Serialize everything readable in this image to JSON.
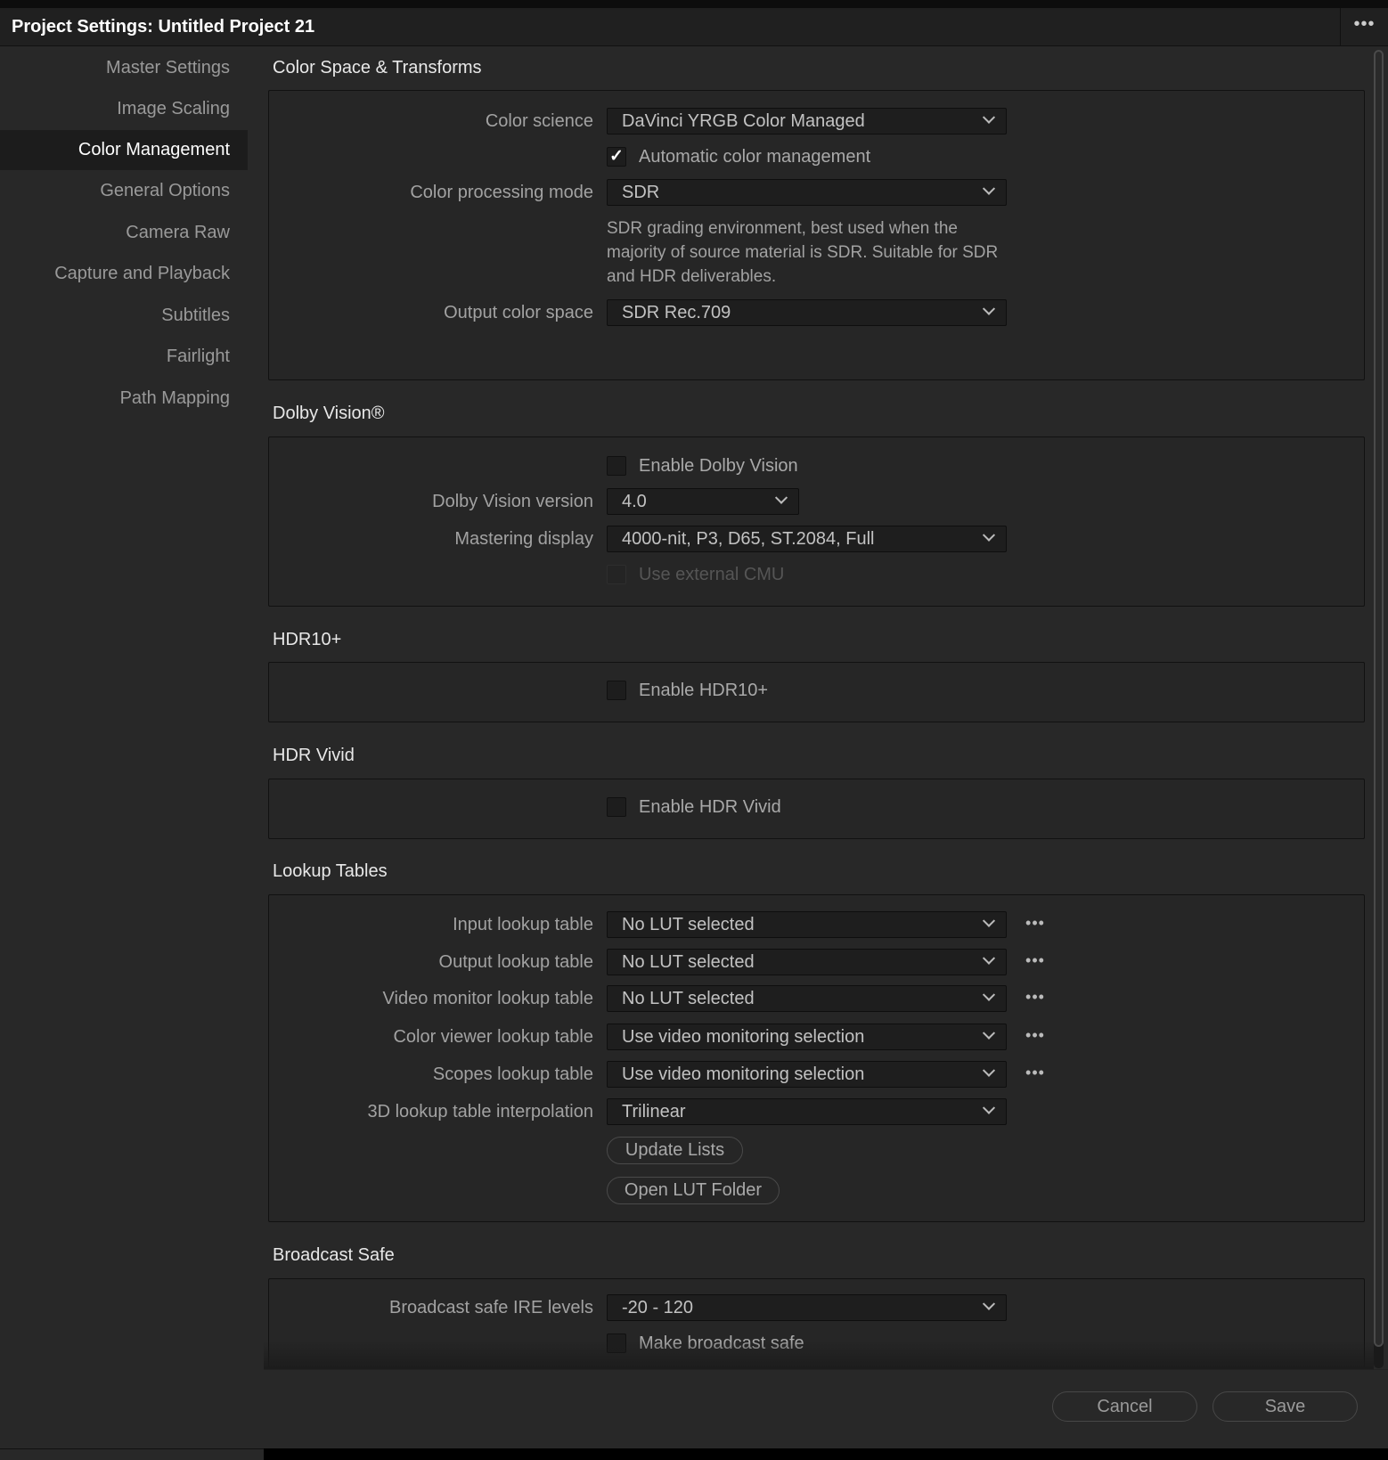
{
  "window": {
    "title": "Project Settings:  Untitled Project 21",
    "menu_icon": "more-horizontal-icon",
    "menu_glyph": "•••"
  },
  "sidebar": {
    "items": [
      {
        "label": "Master Settings"
      },
      {
        "label": "Image Scaling"
      },
      {
        "label": "Color Management",
        "selected": true
      },
      {
        "label": "General Options"
      },
      {
        "label": "Camera Raw"
      },
      {
        "label": "Capture and Playback"
      },
      {
        "label": "Subtitles"
      },
      {
        "label": "Fairlight"
      },
      {
        "label": "Path Mapping"
      }
    ]
  },
  "color_space": {
    "title": "Color Space & Transforms",
    "color_science": {
      "label": "Color science",
      "value": "DaVinci YRGB Color Managed"
    },
    "auto_cm": {
      "label": "Automatic color management",
      "checked": true,
      "glyph": "✓"
    },
    "processing_mode": {
      "label": "Color processing mode",
      "value": "SDR"
    },
    "description": "SDR grading environment, best used when the majority of source material is SDR. Suitable for SDR and HDR deliverables.",
    "output_space": {
      "label": "Output color space",
      "value": "SDR Rec.709"
    }
  },
  "dolby": {
    "title": "Dolby Vision®",
    "enable": {
      "label": "Enable Dolby Vision",
      "checked": false
    },
    "version": {
      "label": "Dolby Vision version",
      "value": "4.0"
    },
    "mastering": {
      "label": "Mastering display",
      "value": "4000-nit, P3, D65, ST.2084, Full"
    },
    "external_cmu": {
      "label": "Use external CMU",
      "checked": false,
      "disabled": true
    }
  },
  "hdr10": {
    "title": "HDR10+",
    "enable": {
      "label": "Enable HDR10+",
      "checked": false
    }
  },
  "hdrvivid": {
    "title": "HDR Vivid",
    "enable": {
      "label": "Enable HDR Vivid",
      "checked": false
    }
  },
  "lut": {
    "title": "Lookup Tables",
    "dots": "•••",
    "input": {
      "label": "Input lookup table",
      "value": "No LUT selected"
    },
    "output": {
      "label": "Output lookup table",
      "value": "No LUT selected"
    },
    "monitor": {
      "label": "Video monitor lookup table",
      "value": "No LUT selected"
    },
    "viewer": {
      "label": "Color viewer lookup table",
      "value": "Use video monitoring selection"
    },
    "scopes": {
      "label": "Scopes lookup table",
      "value": "Use video monitoring selection"
    },
    "interp": {
      "label": "3D lookup table interpolation",
      "value": "Trilinear"
    },
    "update": "Update Lists",
    "open_folder": "Open LUT Folder"
  },
  "broadcast": {
    "title": "Broadcast Safe",
    "ire": {
      "label": "Broadcast safe IRE levels",
      "value": "-20 - 120"
    },
    "make_safe": {
      "label": "Make broadcast safe",
      "checked": false
    }
  },
  "footer": {
    "cancel": "Cancel",
    "save": "Save"
  }
}
